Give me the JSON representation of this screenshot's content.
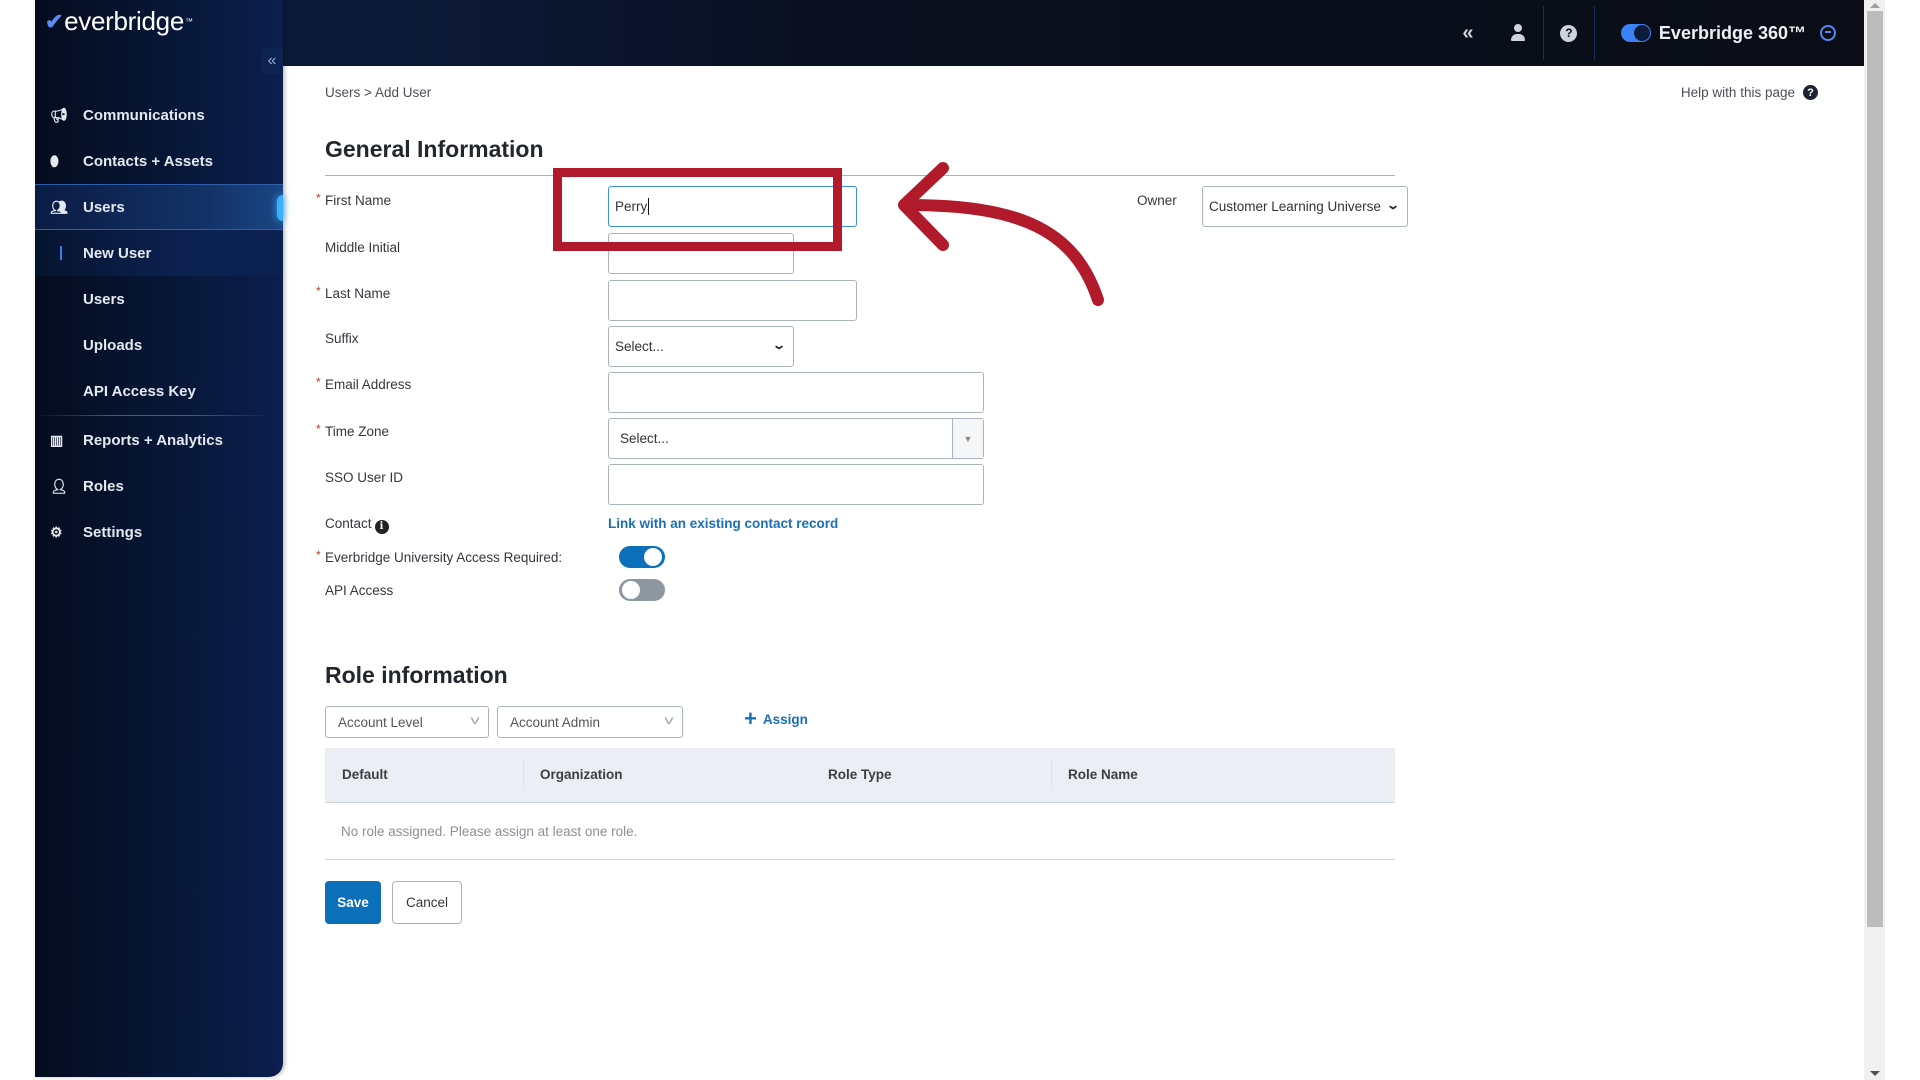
{
  "brand": {
    "logo_text": "everbridge",
    "product_name": "Everbridge 360™",
    "product_toggle_on": true
  },
  "topbar": {
    "collapse_icon": "double-chevron-left-icon",
    "user_icon": "user-icon",
    "help_icon": "help-circle-icon",
    "chat_icon": "chat-icon"
  },
  "sidebar": {
    "collapse_label": "«",
    "items": [
      {
        "label": "Communications",
        "icon": "megaphone-icon"
      },
      {
        "label": "Contacts + Assets",
        "icon": "map-pin-icon"
      },
      {
        "label": "Users",
        "icon": "users-icon",
        "active": true
      },
      {
        "label": "Reports + Analytics",
        "icon": "chart-icon"
      },
      {
        "label": "Roles",
        "icon": "user-role-icon"
      },
      {
        "label": "Settings",
        "icon": "gear-icon"
      }
    ],
    "sub_items": [
      {
        "label": "New User",
        "current": true
      },
      {
        "label": "Users"
      },
      {
        "label": "Uploads"
      },
      {
        "label": "API Access Key"
      }
    ]
  },
  "breadcrumb": {
    "parent": "Users",
    "separator": ">",
    "current": "Add User"
  },
  "help": {
    "label": "Help with this page"
  },
  "general": {
    "title": "General Information",
    "first_name": {
      "label": "First Name",
      "required": true,
      "value": "Perry"
    },
    "middle_initial": {
      "label": "Middle Initial",
      "value": ""
    },
    "last_name": {
      "label": "Last Name",
      "required": true,
      "value": ""
    },
    "suffix": {
      "label": "Suffix",
      "value": "Select..."
    },
    "email": {
      "label": "Email Address",
      "required": true,
      "value": ""
    },
    "time_zone": {
      "label": "Time Zone",
      "required": true,
      "value": "Select..."
    },
    "sso_user_id": {
      "label": "SSO User ID",
      "value": ""
    },
    "contact": {
      "label": "Contact",
      "link": "Link with an existing contact record"
    },
    "eu_access": {
      "label": "Everbridge University Access Required:",
      "required": true,
      "on": true
    },
    "api_access": {
      "label": "API Access",
      "on": false
    },
    "owner": {
      "label": "Owner",
      "value": "Customer Learning Universe"
    }
  },
  "roles": {
    "title": "Role information",
    "level_select": "Account Level",
    "role_select": "Account Admin",
    "assign_label": "Assign",
    "columns": [
      "Default",
      "Organization",
      "Role Type",
      "Role Name"
    ],
    "empty_message": "No role assigned. Please assign at least one role."
  },
  "actions": {
    "save": "Save",
    "cancel": "Cancel"
  },
  "annotation": {
    "color": "#b01a2a"
  }
}
